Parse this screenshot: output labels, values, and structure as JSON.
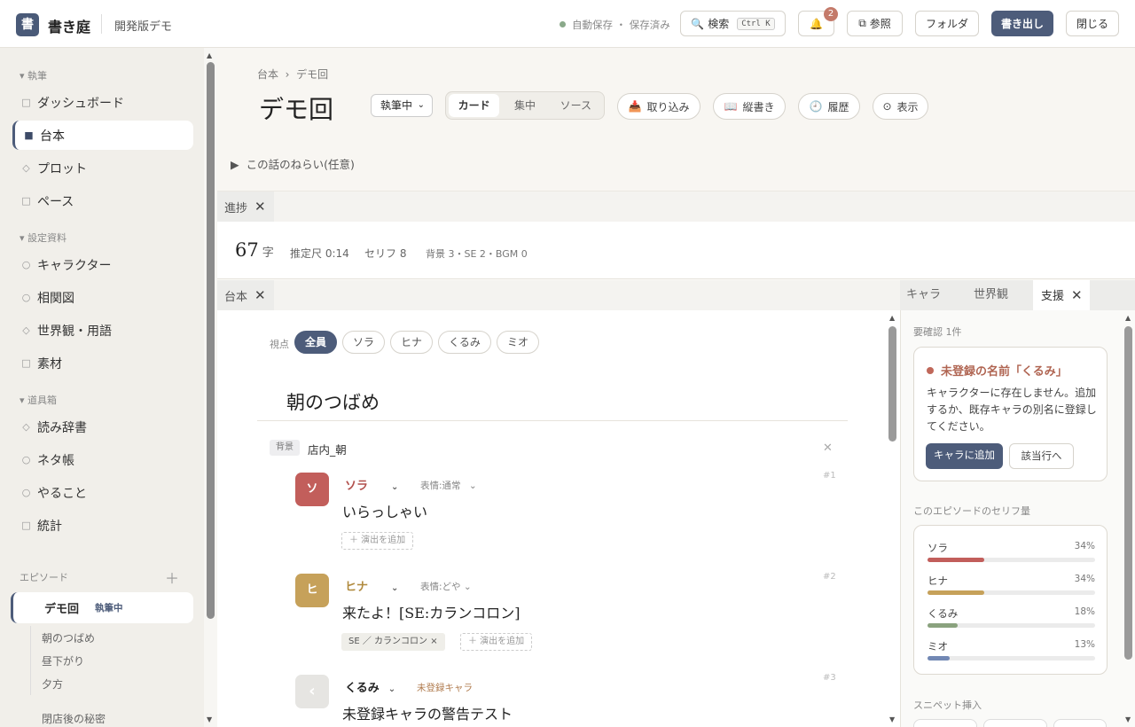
{
  "app": {
    "logo": "書",
    "name": "書き庭",
    "edition": "開発版デモ",
    "save_status": "自動保存 ・ 保存済み",
    "notification_count": "2"
  },
  "toolbar": {
    "search": "検索",
    "search_shortcut": "Ctrl K",
    "bell_icon": "🔔",
    "refer": "参照",
    "folder": "フォルダ",
    "export": "書き出し",
    "close": "閉じる"
  },
  "sidebar": {
    "sections": {
      "writing": "執筆",
      "settings": "設定資料",
      "tools": "道具箱",
      "episodes": "エピソード"
    },
    "items": [
      {
        "label": "ダッシュボード",
        "icon": "□"
      },
      {
        "label": "台本",
        "icon": "■"
      },
      {
        "label": "プロット",
        "icon": "◇"
      },
      {
        "label": "ペース",
        "icon": "□"
      },
      {
        "label": "キャラクター",
        "icon": "○"
      },
      {
        "label": "相関図",
        "icon": "○"
      },
      {
        "label": "世界観・用語",
        "icon": "◇"
      },
      {
        "label": "素材",
        "icon": "□"
      },
      {
        "label": "読み辞書",
        "icon": "◇"
      },
      {
        "label": "ネタ帳",
        "icon": "○"
      },
      {
        "label": "やること",
        "icon": "○"
      },
      {
        "label": "統計",
        "icon": "□"
      }
    ],
    "current_episode": {
      "title": "デモ回",
      "status": "執筆中"
    },
    "scenes": [
      "朝のつばめ",
      "昼下がり",
      "夕方"
    ],
    "next_episode": "閉店後の秘密"
  },
  "header": {
    "breadcrumb_root": "台本",
    "breadcrumb_sep": "›",
    "breadcrumb_current": "デモ回",
    "title": "デモ回",
    "status": "執筆中",
    "views": [
      "カード",
      "集中",
      "ソース"
    ],
    "import": "取り込み",
    "vertical": "縦書き",
    "history": "履歴",
    "display": "表示",
    "aims": "この話のねらい(任意)"
  },
  "progress": {
    "tab": "進捗",
    "chars": "67",
    "chars_unit": "字",
    "duration": "推定尺 0:14",
    "lines": "セリフ 8",
    "assets": "背景 3・SE 2・BGM 0"
  },
  "script": {
    "tab": "台本",
    "pov_label": "視点",
    "pov": [
      "全員",
      "ソラ",
      "ヒナ",
      "くるみ",
      "ミオ"
    ],
    "scene_title": "朝のつばめ",
    "bg_tag": "背景",
    "bg_value": "店内_朝",
    "add_direction": "＋ 演出を追加",
    "lines": [
      {
        "avatar": "ソ",
        "name": "ソラ",
        "expression": "表情:通常",
        "text": "いらっしゃい",
        "num": "#1",
        "color": "#c25e5b"
      },
      {
        "avatar": "ヒ",
        "name": "ヒナ",
        "expression": "表情:どや",
        "text": "来たよ！[SE:カランコロン]",
        "num": "#2",
        "color": "#c6a15a",
        "se": "SE ／ カランコロン ×"
      },
      {
        "avatar": "‹",
        "name": "くるみ",
        "expression": "",
        "text": "未登録キャラの警告テスト",
        "num": "#3",
        "color": "#e6e5e2",
        "unregistered": "未登録キャラ"
      }
    ]
  },
  "support": {
    "tabs": [
      "キャラ",
      "世界観",
      "支援"
    ],
    "review_label": "要確認 1件",
    "warning_title": "未登録の名前「くるみ」",
    "warning_body": "キャラクターに存在しません。追加するか、既存キャラの別名に登録してください。",
    "add_button": "キャラに追加",
    "goto_button": "該当行へ",
    "stats_label": "このエピソードのセリフ量",
    "stats": [
      {
        "name": "ソラ",
        "pct": "34%",
        "value": 34,
        "color": "#c25e5b"
      },
      {
        "name": "ヒナ",
        "pct": "34%",
        "value": 34,
        "color": "#c6a15a"
      },
      {
        "name": "くるみ",
        "pct": "18%",
        "value": 18,
        "color": "#8aa27e"
      },
      {
        "name": "ミオ",
        "pct": "13%",
        "value": 13,
        "color": "#7288b4"
      }
    ],
    "snippet_label": "スニペット挿入"
  }
}
